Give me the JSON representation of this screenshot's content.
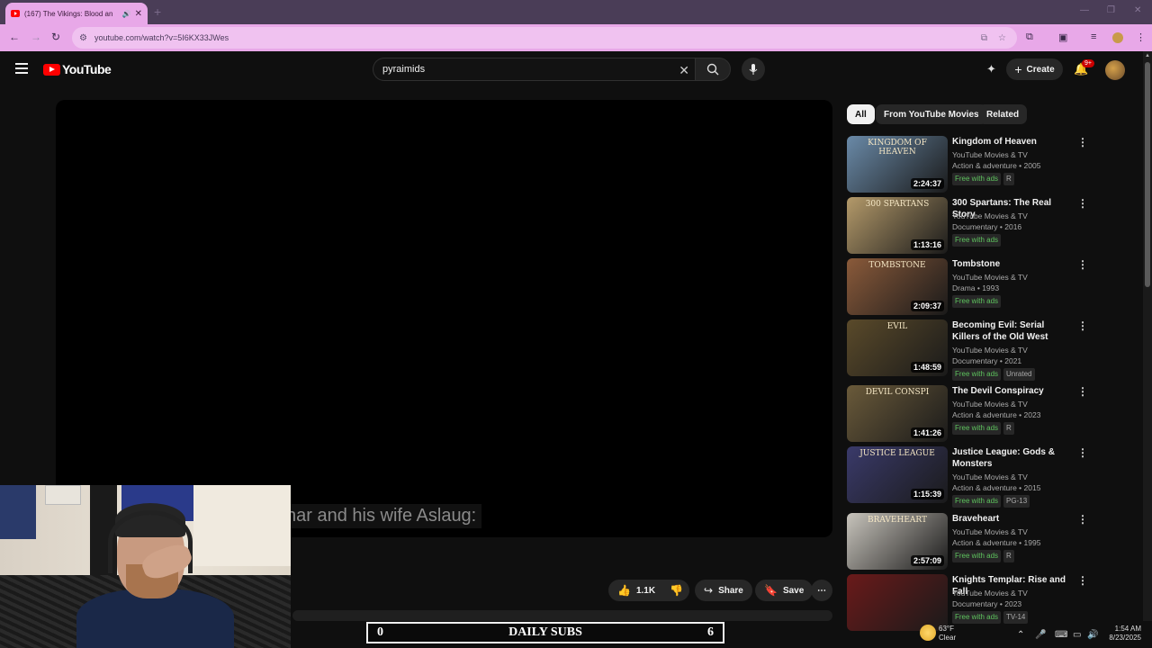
{
  "browser": {
    "tab_title": "(167) The Vikings: Blood an",
    "url": "youtube.com/watch?v=5I6KX33JWes"
  },
  "masthead": {
    "logo_text": "YouTube",
    "search_value": "pyraimids",
    "create_label": "Create",
    "notif_count": "9+"
  },
  "player": {
    "caption": "nar and his wife Aslaug:"
  },
  "actions": {
    "likes": "1.1K",
    "share": "Share",
    "save": "Save"
  },
  "chips": [
    "All",
    "From YouTube Movies",
    "Related"
  ],
  "recommendations": [
    {
      "title": "Kingdom of Heaven",
      "channel": "YouTube Movies & TV",
      "meta": "Action & adventure • 2005",
      "duration": "2:24:37",
      "badges": [
        "Free with ads",
        "R"
      ],
      "thumb_text": "KINGDOM OF HEAVEN",
      "color": "#6a8aa8"
    },
    {
      "title": "300 Spartans: The Real Story",
      "channel": "YouTube Movies & TV",
      "meta": "Documentary • 2016",
      "duration": "1:13:16",
      "badges": [
        "Free with ads"
      ],
      "thumb_text": "300 SPARTANS",
      "color": "#b49a6a"
    },
    {
      "title": "Tombstone",
      "channel": "YouTube Movies & TV",
      "meta": "Drama • 1993",
      "duration": "2:09:37",
      "badges": [
        "Free with ads"
      ],
      "thumb_text": "TOMBSTONE",
      "color": "#8a5a3a"
    },
    {
      "title": "Becoming Evil: Serial Killers of the Old West",
      "channel": "YouTube Movies & TV",
      "meta": "Documentary • 2021",
      "duration": "1:48:59",
      "badges": [
        "Free with ads",
        "Unrated"
      ],
      "thumb_text": "EVIL",
      "color": "#5a4a2a"
    },
    {
      "title": "The Devil Conspiracy",
      "channel": "YouTube Movies & TV",
      "meta": "Action & adventure • 2023",
      "duration": "1:41:26",
      "badges": [
        "Free with ads",
        "R"
      ],
      "thumb_text": "DEVIL CONSPI",
      "color": "#6a5a3a"
    },
    {
      "title": "Justice League: Gods & Monsters",
      "channel": "YouTube Movies & TV",
      "meta": "Action & adventure • 2015",
      "duration": "1:15:39",
      "badges": [
        "Free with ads",
        "PG-13"
      ],
      "thumb_text": "JUSTICE LEAGUE",
      "color": "#3a3a6a"
    },
    {
      "title": "Braveheart",
      "channel": "YouTube Movies & TV",
      "meta": "Action & adventure • 1995",
      "duration": "2:57:09",
      "badges": [
        "Free with ads",
        "R"
      ],
      "thumb_text": "BRAVEHEART",
      "color": "#c8c4bc"
    },
    {
      "title": "Knights Templar: Rise and Fall",
      "channel": "YouTube Movies & TV",
      "meta": "Documentary • 2023",
      "duration": "",
      "badges": [
        "Free with ads",
        "TV-14"
      ],
      "thumb_text": "",
      "color": "#6a1a1a"
    }
  ],
  "subs": {
    "left": "0",
    "label": "DAILY SUBS",
    "right": "6"
  },
  "taskbar": {
    "temp": "63°F",
    "weather": "Clear",
    "time": "1:54 AM",
    "date": "8/23/2025"
  }
}
